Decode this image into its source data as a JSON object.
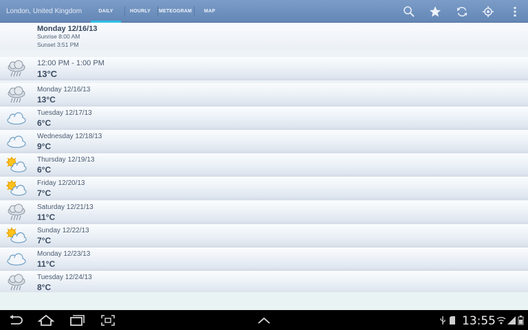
{
  "header": {
    "location": "London, United Kingdom",
    "tabs": [
      {
        "label": "DAILY",
        "active": true
      },
      {
        "label": "HOURLY",
        "active": false
      },
      {
        "label": "METEOGRAM",
        "active": false
      },
      {
        "label": "MAP",
        "active": false
      }
    ],
    "actions": [
      "search-icon",
      "star-icon",
      "refresh-icon",
      "locate-icon",
      "overflow-menu-icon"
    ],
    "accent_color": "#2fc0e8",
    "bar_color": "#6f92bf"
  },
  "summary": {
    "date": "Monday 12/16/13",
    "sunrise": "Sunrise 8:00 AM",
    "sunset": "Sunset 3:51 PM"
  },
  "current": {
    "time": "12:00 PM - 1:00 PM",
    "temp": "13°C",
    "icon": "rain-cloud-icon"
  },
  "days": [
    {
      "date": "Monday 12/16/13",
      "temp": "13°C",
      "icon": "rain-cloud-icon"
    },
    {
      "date": "Tuesday 12/17/13",
      "temp": "6°C",
      "icon": "cloud-icon"
    },
    {
      "date": "Wednesday 12/18/13",
      "temp": "9°C",
      "icon": "cloud-icon"
    },
    {
      "date": "Thursday 12/19/13",
      "temp": "6°C",
      "icon": "sun-cloud-icon"
    },
    {
      "date": "Friday 12/20/13",
      "temp": "7°C",
      "icon": "sun-cloud-icon"
    },
    {
      "date": "Saturday 12/21/13",
      "temp": "11°C",
      "icon": "rain-cloud-icon"
    },
    {
      "date": "Sunday 12/22/13",
      "temp": "7°C",
      "icon": "sun-cloud-icon"
    },
    {
      "date": "Monday 12/23/13",
      "temp": "11°C",
      "icon": "cloud-icon"
    },
    {
      "date": "Tuesday 12/24/13",
      "temp": "8°C",
      "icon": "rain-cloud-icon"
    }
  ],
  "system": {
    "time": "13:55",
    "nav": [
      "back-icon",
      "home-icon",
      "recent-apps-icon",
      "screenshot-icon",
      "up-chevron-icon"
    ],
    "status": [
      "usb-icon",
      "sd-card-icon",
      "wifi-icon",
      "signal-icon",
      "battery-icon"
    ]
  }
}
